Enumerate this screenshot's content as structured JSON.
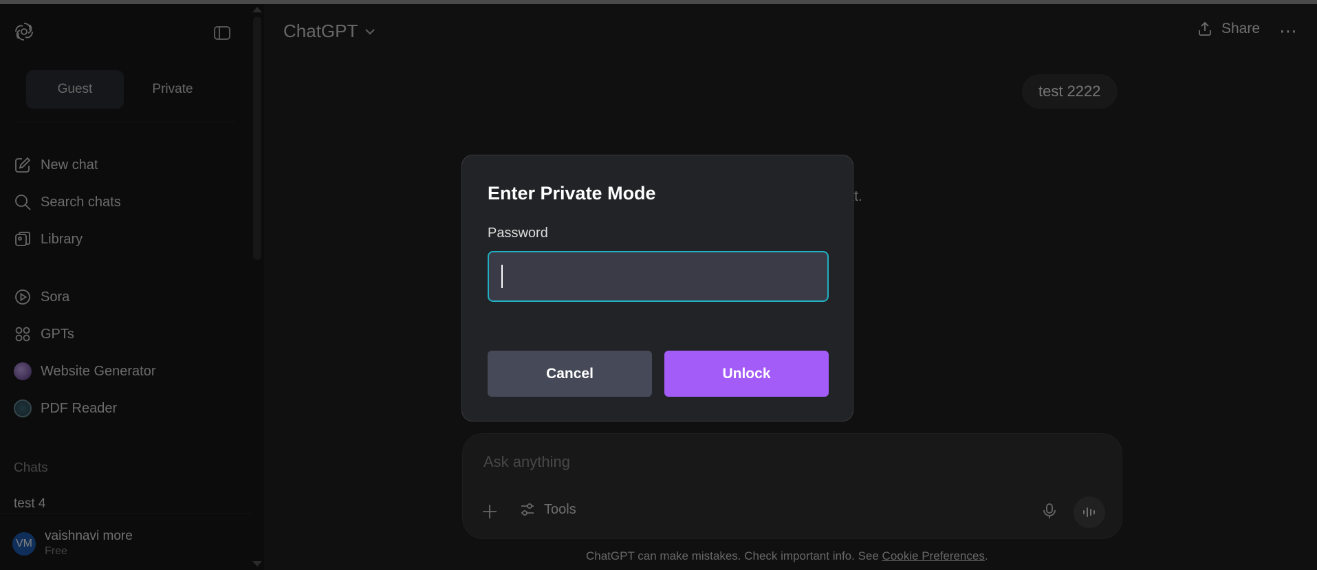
{
  "sidebar": {
    "mode_tabs": [
      {
        "label": "Guest",
        "active": true
      },
      {
        "label": "Private",
        "active": false
      }
    ],
    "nav": {
      "new_chat": "New chat",
      "search_chats": "Search chats",
      "library": "Library",
      "sora": "Sora",
      "gpts": "GPTs",
      "website_generator": "Website Generator",
      "pdf_reader": "PDF Reader"
    },
    "chats_label": "Chats",
    "chats": [
      "test 4"
    ],
    "user": {
      "initials": "VM",
      "name": "vaishnavi more",
      "plan": "Free"
    }
  },
  "header": {
    "model": "ChatGPT",
    "share_label": "Share",
    "more_label": "⋯"
  },
  "conversation": {
    "user_message": "test 2222",
    "assistant_fragment": "ext."
  },
  "composer": {
    "placeholder": "Ask anything",
    "tools_label": "Tools"
  },
  "footer": {
    "disclaimer_prefix": "ChatGPT can make mistakes. Check important info. See ",
    "disclaimer_link": "Cookie Preferences",
    "disclaimer_suffix": "."
  },
  "modal": {
    "title": "Enter Private Mode",
    "password_label": "Password",
    "password_value": "",
    "cancel_label": "Cancel",
    "unlock_label": "Unlock"
  },
  "colors": {
    "accent_unlock": "#a45cf8",
    "input_focus": "#1fb1c4",
    "cancel_bg": "#464a58",
    "avatar_bg": "#1e5fb5"
  }
}
